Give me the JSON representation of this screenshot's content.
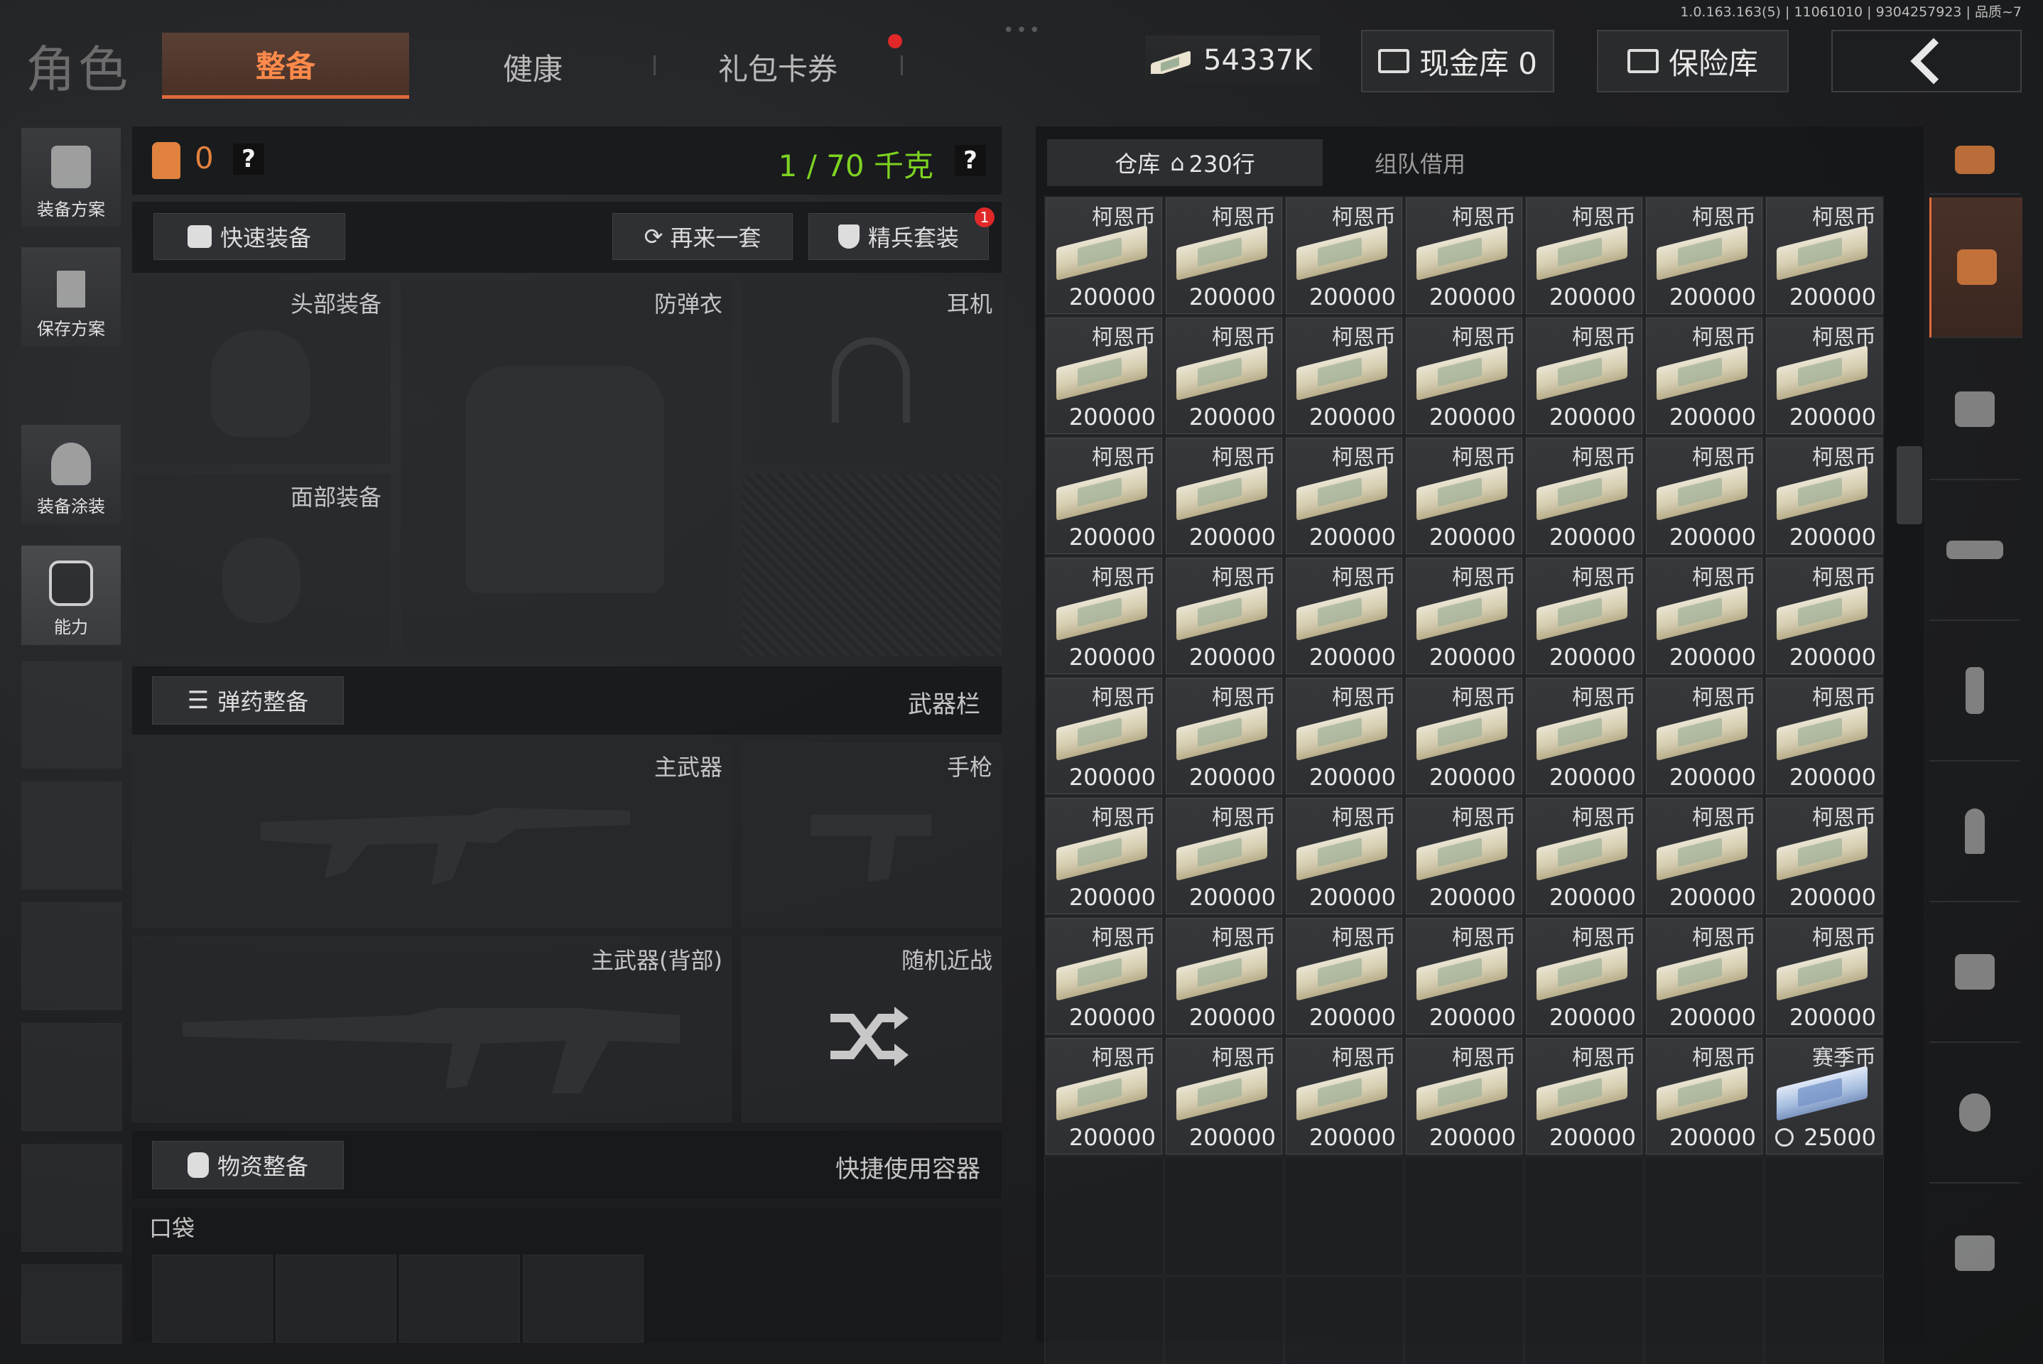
{
  "version": "1.0.163.163(5) | 11061010 | 9304257923 | 品质~7",
  "header": {
    "title": "角色",
    "tabs": [
      {
        "label": "整备",
        "active": true
      },
      {
        "label": "健康",
        "active": false
      },
      {
        "label": "礼包卡券",
        "active": false,
        "notification": true
      }
    ],
    "money": "54337K",
    "cash_vault": "现金库 0",
    "safe_vault": "保险库"
  },
  "sidebar": {
    "items": [
      {
        "label": "装备方案",
        "icon": "armor-plan-icon"
      },
      {
        "label": "保存方案",
        "icon": "download-icon"
      },
      {
        "label": "装备涂装",
        "icon": "helmet-paint-icon"
      },
      {
        "label": "能力",
        "icon": "ability-icon"
      }
    ]
  },
  "loadout": {
    "backpack_count": "0",
    "weight": "1 / 70 千克",
    "help": "?",
    "quick_equip": "快速装备",
    "repeat_set": "再来一套",
    "elite_set": "精兵套装",
    "elite_badge": "1",
    "slots": {
      "head": "头部装备",
      "armor": "防弹衣",
      "headset": "耳机",
      "face": "面部装备",
      "primary": "主武器",
      "pistol": "手枪",
      "primary_back": "主武器(背部)",
      "melee": "随机近战"
    },
    "ammo_equip": "弹药整备",
    "weapon_bar": "武器栏",
    "supply_equip": "物资整备",
    "quick_container": "快捷使用容器",
    "pocket": "口袋"
  },
  "warehouse": {
    "tab_storage": "仓库",
    "rows": "230行",
    "tab_team": "组队借用",
    "items": [
      {
        "name": "柯恩币",
        "value": "200000"
      },
      {
        "name": "柯恩币",
        "value": "200000"
      },
      {
        "name": "柯恩币",
        "value": "200000"
      },
      {
        "name": "柯恩币",
        "value": "200000"
      },
      {
        "name": "柯恩币",
        "value": "200000"
      },
      {
        "name": "柯恩币",
        "value": "200000"
      },
      {
        "name": "柯恩币",
        "value": "200000"
      },
      {
        "name": "柯恩币",
        "value": "200000"
      },
      {
        "name": "柯恩币",
        "value": "200000"
      },
      {
        "name": "柯恩币",
        "value": "200000"
      },
      {
        "name": "柯恩币",
        "value": "200000"
      },
      {
        "name": "柯恩币",
        "value": "200000"
      },
      {
        "name": "柯恩币",
        "value": "200000"
      },
      {
        "name": "柯恩币",
        "value": "200000"
      },
      {
        "name": "柯恩币",
        "value": "200000"
      },
      {
        "name": "柯恩币",
        "value": "200000"
      },
      {
        "name": "柯恩币",
        "value": "200000"
      },
      {
        "name": "柯恩币",
        "value": "200000"
      },
      {
        "name": "柯恩币",
        "value": "200000"
      },
      {
        "name": "柯恩币",
        "value": "200000"
      },
      {
        "name": "柯恩币",
        "value": "200000"
      },
      {
        "name": "柯恩币",
        "value": "200000"
      },
      {
        "name": "柯恩币",
        "value": "200000"
      },
      {
        "name": "柯恩币",
        "value": "200000"
      },
      {
        "name": "柯恩币",
        "value": "200000"
      },
      {
        "name": "柯恩币",
        "value": "200000"
      },
      {
        "name": "柯恩币",
        "value": "200000"
      },
      {
        "name": "柯恩币",
        "value": "200000"
      },
      {
        "name": "柯恩币",
        "value": "200000"
      },
      {
        "name": "柯恩币",
        "value": "200000"
      },
      {
        "name": "柯恩币",
        "value": "200000"
      },
      {
        "name": "柯恩币",
        "value": "200000"
      },
      {
        "name": "柯恩币",
        "value": "200000"
      },
      {
        "name": "柯恩币",
        "value": "200000"
      },
      {
        "name": "柯恩币",
        "value": "200000"
      },
      {
        "name": "柯恩币",
        "value": "200000"
      },
      {
        "name": "柯恩币",
        "value": "200000"
      },
      {
        "name": "柯恩币",
        "value": "200000"
      },
      {
        "name": "柯恩币",
        "value": "200000"
      },
      {
        "name": "柯恩币",
        "value": "200000"
      },
      {
        "name": "柯恩币",
        "value": "200000"
      },
      {
        "name": "柯恩币",
        "value": "200000"
      },
      {
        "name": "柯恩币",
        "value": "200000"
      },
      {
        "name": "柯恩币",
        "value": "200000"
      },
      {
        "name": "柯恩币",
        "value": "200000"
      },
      {
        "name": "柯恩币",
        "value": "200000"
      },
      {
        "name": "柯恩币",
        "value": "200000"
      },
      {
        "name": "柯恩币",
        "value": "200000"
      },
      {
        "name": "柯恩币",
        "value": "200000"
      },
      {
        "name": "柯恩币",
        "value": "200000"
      },
      {
        "name": "柯恩币",
        "value": "200000"
      },
      {
        "name": "柯恩币",
        "value": "200000"
      },
      {
        "name": "柯恩币",
        "value": "200000"
      },
      {
        "name": "柯恩币",
        "value": "200000"
      },
      {
        "name": "柯恩币",
        "value": "200000"
      },
      {
        "name": "赛季币",
        "value": "25000",
        "season": true
      }
    ]
  },
  "colors": {
    "accent": "#e06a3a",
    "weight_green": "#7ed321",
    "badge_red": "#e02828"
  }
}
